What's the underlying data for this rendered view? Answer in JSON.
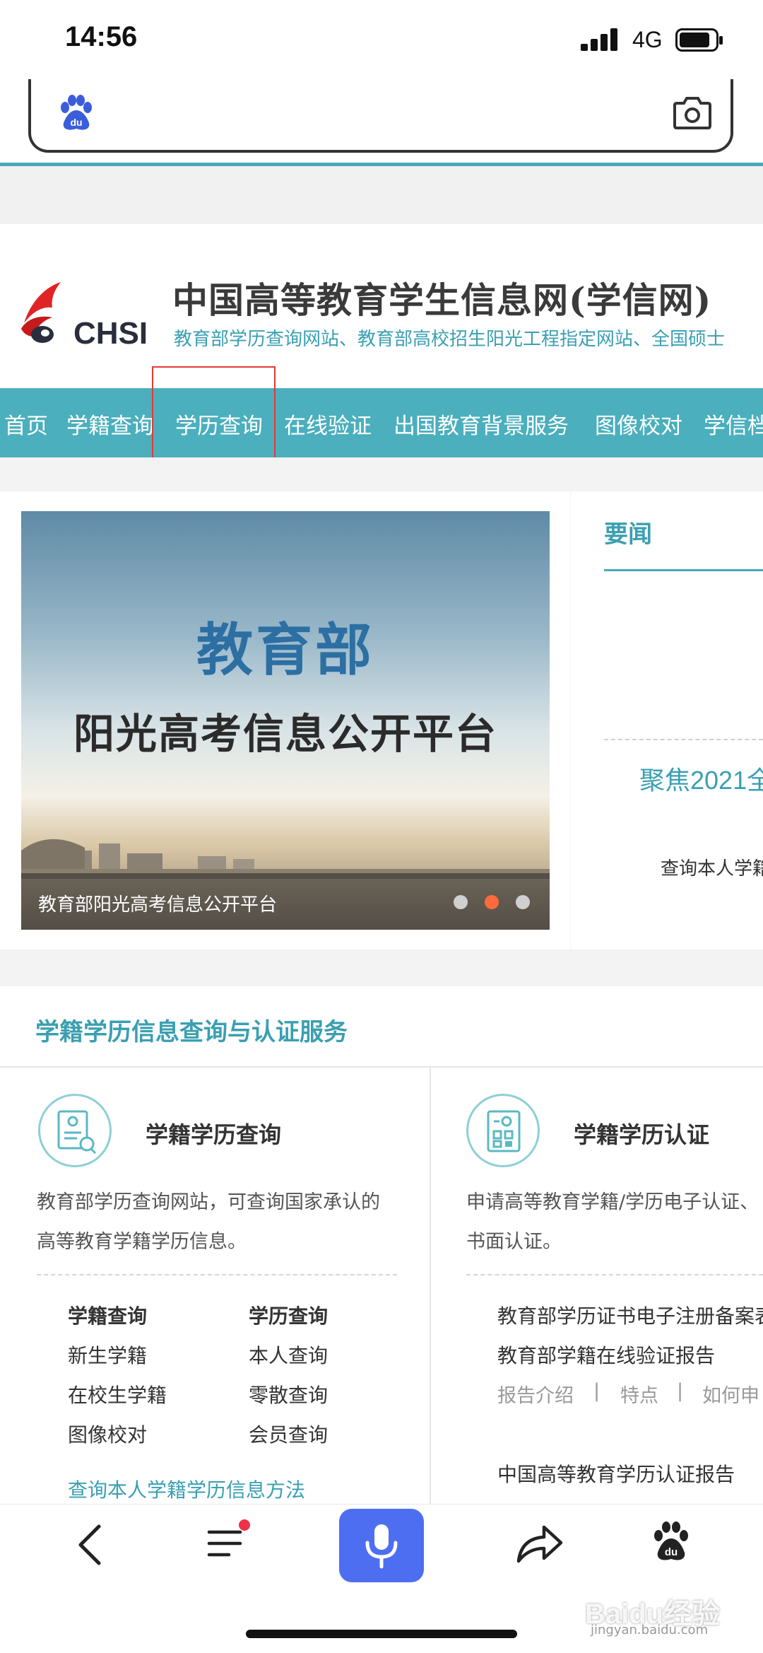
{
  "status_bar": {
    "time": "14:56",
    "network": "4G"
  },
  "search": {
    "placeholder": ""
  },
  "site": {
    "logo_text": "CHSI",
    "title": "中国高等教育学生信息网(学信网)",
    "subtitle": "教育部学历查询网站、教育部高校招生阳光工程指定网站、全国硕士"
  },
  "nav": {
    "items": [
      "首页",
      "学籍查询",
      "学历查询",
      "在线验证",
      "出国教育背景服务",
      "图像校对",
      "学信档"
    ]
  },
  "banner": {
    "headline": "教育部",
    "subheadline": "阳光高考信息公开平台",
    "caption": "教育部阳光高考信息公开平台",
    "active_slide": 2,
    "slide_count": 3,
    "colors": {
      "active_dot": "#ff6a3c",
      "inactive_dot": "#d0d0d0"
    }
  },
  "news": {
    "title": "要闻",
    "item1": "聚焦2021全",
    "item2": "查询本人学籍"
  },
  "services": {
    "section_title": "学籍学历信息查询与认证服务",
    "left": {
      "name": "学籍学历查询",
      "desc_line1": "教育部学历查询网站，可查询国家承认的",
      "desc_line2": "高等教育学籍学历信息。",
      "col1_head": "学籍查询",
      "col1_items": [
        "新生学籍",
        "在校生学籍",
        "图像校对"
      ],
      "col2_head": "学历查询",
      "col2_items": [
        "本人查询",
        "零散查询",
        "会员查询"
      ],
      "method_link": "查询本人学籍学历信息方法"
    },
    "right": {
      "name": "学籍学历认证",
      "desc_line1": "申请高等教育学籍/学历电子认证、",
      "desc_line2": "书面认证。",
      "item1": "教育部学历证书电子注册备案表",
      "item2": "教育部学籍在线验证报告",
      "links": [
        "报告介绍",
        "特点",
        "如何申"
      ],
      "separator": "|",
      "item3": "中国高等教育学历认证报告"
    }
  },
  "toolbar": {
    "icons": [
      "back-icon",
      "menu-icon",
      "mic-icon",
      "share-icon",
      "baidu-paw-icon"
    ],
    "accent": "#4e6ef2"
  },
  "watermark": {
    "text": "Baidu经验",
    "url": "jingyan.baidu.com"
  }
}
